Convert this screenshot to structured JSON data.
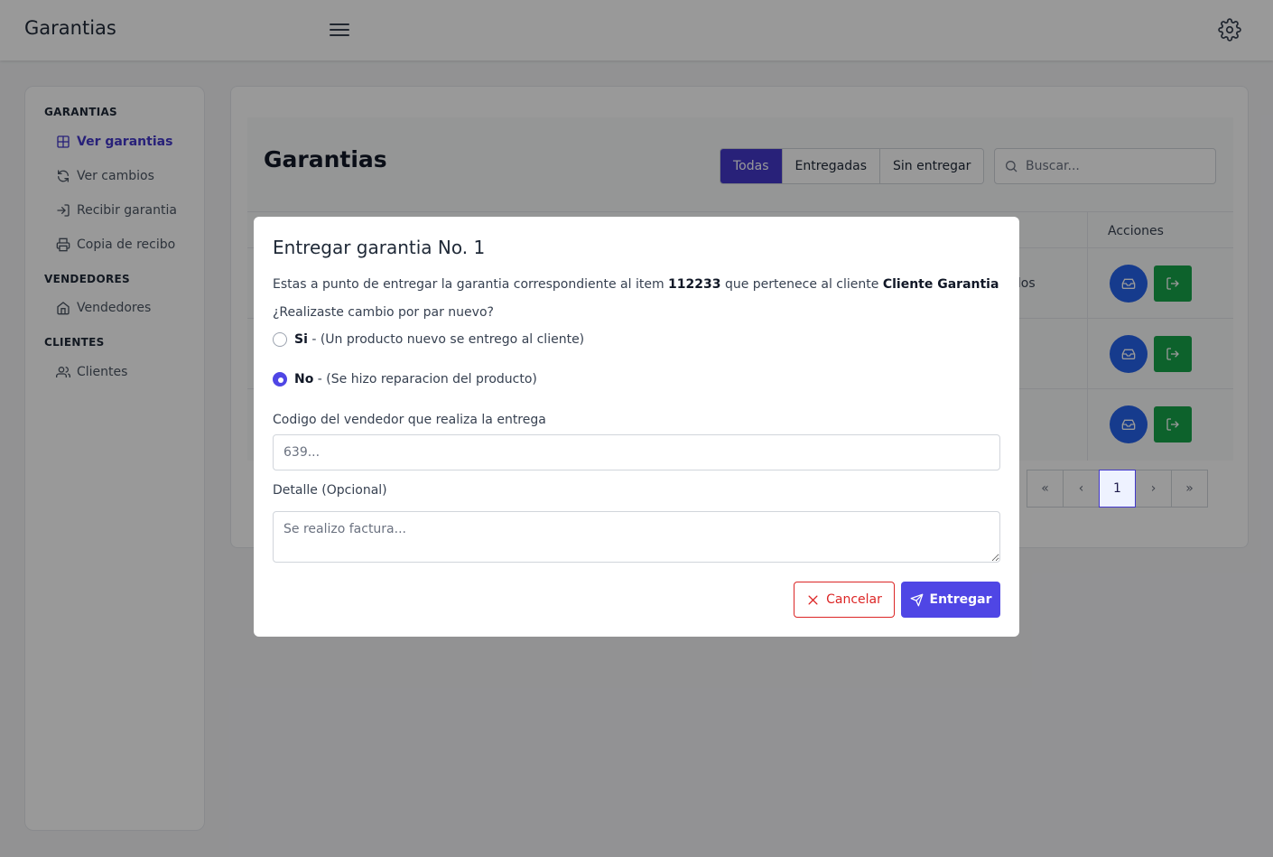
{
  "app": {
    "title": "Garantias"
  },
  "sidebar": {
    "sections": [
      {
        "title": "GARANTIAS",
        "items": [
          {
            "label": "Ver garantias",
            "icon": "table-icon",
            "active": true
          },
          {
            "label": "Ver cambios",
            "icon": "refresh-icon"
          },
          {
            "label": "Recibir garantia",
            "icon": "login-arrow-icon"
          },
          {
            "label": "Copia de recibo",
            "icon": "printer-icon"
          }
        ]
      },
      {
        "title": "VENDEDORES",
        "items": [
          {
            "label": "Vendedores",
            "icon": "home-icon"
          }
        ]
      },
      {
        "title": "CLIENTES",
        "items": [
          {
            "label": "Clientes",
            "icon": "users-icon"
          }
        ]
      }
    ]
  },
  "main": {
    "title": "Garantias",
    "filters": [
      "Todas",
      "Entregadas",
      "Sin entregar"
    ],
    "search_placeholder": "Buscar...",
    "table": {
      "header_actions": "Acciones",
      "visible_cell_fragment": "ndos"
    },
    "pagination": {
      "first": "«",
      "prev": "‹",
      "current": "1",
      "next": "›",
      "last": "»"
    }
  },
  "modal": {
    "title": "Entregar garantia No. 1",
    "desc_prefix": "Estas a punto de entregar la garantia correspondiente al item ",
    "item": "112233",
    "desc_middle": " que pertenece al cliente ",
    "client": "Cliente Garantia",
    "question": "¿Realizaste cambio por par nuevo?",
    "options": [
      {
        "strong": "Si",
        "rest": " - (Un producto nuevo se entrego al cliente)",
        "checked": false
      },
      {
        "strong": "No",
        "rest": " - (Se hizo reparacion del producto)",
        "checked": true
      }
    ],
    "seller_label": "Codigo del vendedor que realiza la entrega",
    "seller_placeholder": "639...",
    "detail_label": "Detalle (Opcional)",
    "detail_placeholder": "Se realizo factura...",
    "cancel_label": "Cancelar",
    "submit_label": "Entregar"
  },
  "colors": {
    "primary": "#4338ca",
    "submit": "#4f46e5",
    "danger": "#dc2626",
    "success": "#16a34a",
    "info": "#2563eb"
  }
}
